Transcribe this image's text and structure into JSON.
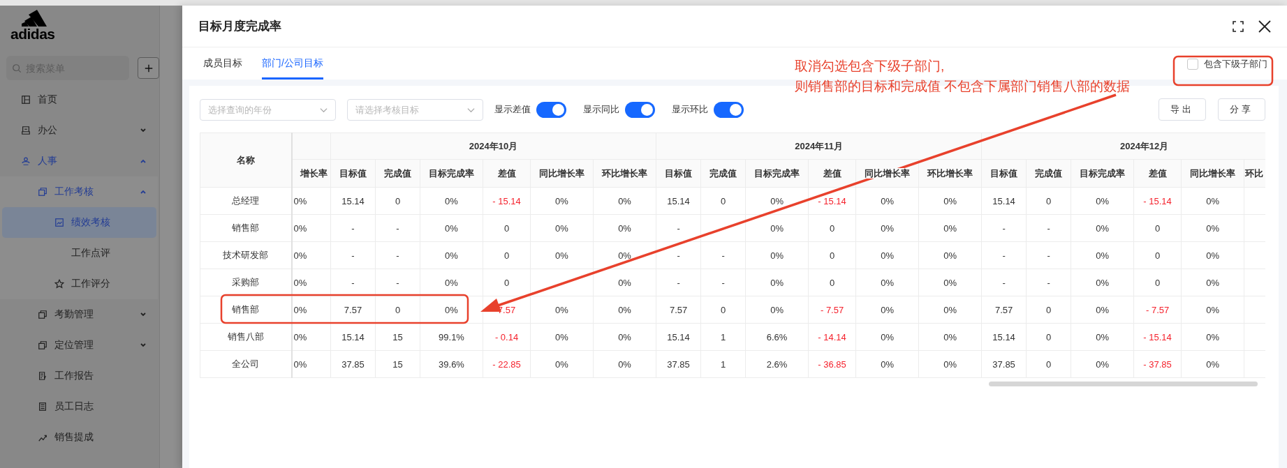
{
  "app": {
    "logo_text": "adidas",
    "search_placeholder": "搜索菜单",
    "menu": [
      {
        "label": "首页",
        "selected": false
      },
      {
        "label": "办公",
        "expanded": false,
        "selected": false
      },
      {
        "label": "人事",
        "expanded": true,
        "selected": false,
        "children": [
          {
            "label": "工作考核",
            "expanded": true,
            "selected": false,
            "children": [
              {
                "label": "绩效考核",
                "selected": true
              },
              {
                "label": "工作点评",
                "selected": false
              },
              {
                "label": "工作评分",
                "selected": false
              }
            ]
          },
          {
            "label": "考勤管理",
            "expanded": false,
            "selected": false
          },
          {
            "label": "定位管理",
            "expanded": false,
            "selected": false
          },
          {
            "label": "工作报告",
            "selected": false
          },
          {
            "label": "员工日志",
            "selected": false
          },
          {
            "label": "销售提成",
            "selected": false
          }
        ]
      }
    ]
  },
  "drawer": {
    "title": "目标月度完成率",
    "tabs": [
      {
        "label": "成员目标",
        "selected": false
      },
      {
        "label": "部门/公司目标",
        "selected": true
      }
    ],
    "include_sub": {
      "label": "包含下级子部门",
      "checked": false
    },
    "filters": [
      {
        "placeholder": "选择查询的年份"
      },
      {
        "placeholder": "请选择考核目标"
      }
    ],
    "toggles": [
      {
        "label": "显示差值",
        "on": true
      },
      {
        "label": "显示同比",
        "on": true
      },
      {
        "label": "显示环比",
        "on": true
      }
    ],
    "buttons": [
      "导出",
      "分享"
    ],
    "table": {
      "name_header": "名称",
      "lead_header": "增长率",
      "months": [
        {
          "label": "2024年10月",
          "columns": [
            "目标值",
            "完成值",
            "目标完成率",
            "差值",
            "同比增长率",
            "环比增长率"
          ]
        },
        {
          "label": "2024年11月",
          "columns": [
            "目标值",
            "完成值",
            "目标完成率",
            "差值",
            "同比增长率",
            "环比增长率"
          ]
        },
        {
          "label": "2024年12月",
          "columns": [
            "目标值",
            "完成值",
            "目标完成率",
            "差值",
            "同比增长率",
            "环比"
          ]
        }
      ],
      "rows": [
        {
          "name": "总经理",
          "lead": "0%",
          "months": [
            {
              "target": "15.14",
              "done": "0",
              "rate": "0%",
              "diff": "- 15.14",
              "negative": true,
              "yoy": "0%",
              "mom": "0%"
            },
            {
              "target": "15.14",
              "done": "0",
              "rate": "0%",
              "diff": "- 15.14",
              "negative": true,
              "yoy": "0%",
              "mom": "0%"
            },
            {
              "target": "15.14",
              "done": "0",
              "rate": "0%",
              "diff": "- 15.14",
              "negative": true,
              "yoy": "0%"
            }
          ]
        },
        {
          "name": "销售部",
          "lead": "0%",
          "months": [
            {
              "target": "-",
              "done": "-",
              "rate": "0%",
              "diff": "0",
              "negative": false,
              "yoy": "0%",
              "mom": "0%"
            },
            {
              "target": "-",
              "rate": "0%",
              "diff": "0",
              "negative": false,
              "yoy": "0%",
              "mom": "0%"
            },
            {
              "target": "-",
              "done": "-",
              "rate": "0%",
              "diff": "0",
              "negative": false,
              "yoy": "0%"
            }
          ]
        },
        {
          "name": "技术研发部",
          "lead": "0%",
          "months": [
            {
              "target": "-",
              "done": "-",
              "rate": "0%",
              "diff": "0",
              "negative": false,
              "yoy": "0%",
              "mom": "0%"
            },
            {
              "target": "-",
              "done": "-",
              "rate": "0%",
              "diff": "0",
              "negative": false,
              "yoy": "0%",
              "mom": "0%"
            },
            {
              "target": "-",
              "done": "-",
              "rate": "0%",
              "diff": "0",
              "negative": false,
              "yoy": "0%"
            }
          ]
        },
        {
          "name": "采购部",
          "lead": "0%",
          "months": [
            {
              "target": "-",
              "done": "-",
              "rate": "0%",
              "diff": "0",
              "negative": false,
              "mom": "0%"
            },
            {
              "target": "-",
              "done": "-",
              "rate": "0%",
              "diff": "0",
              "negative": false,
              "yoy": "0%",
              "mom": "0%"
            },
            {
              "target": "-",
              "done": "-",
              "rate": "0%",
              "diff": "0",
              "negative": false,
              "yoy": "0%"
            }
          ]
        },
        {
          "name": "销售部",
          "lead": "0%",
          "months": [
            {
              "target": "7.57",
              "done": "0",
              "rate": "0%",
              "diff": "7.57",
              "negative": true,
              "yoy": "0%",
              "mom": "0%"
            },
            {
              "target": "7.57",
              "done": "0",
              "rate": "0%",
              "diff": "- 7.57",
              "negative": true,
              "yoy": "0%",
              "mom": "0%"
            },
            {
              "target": "7.57",
              "done": "0",
              "rate": "0%",
              "diff": "- 7.57",
              "negative": true,
              "yoy": "0%"
            }
          ]
        },
        {
          "name": "销售八部",
          "lead": "0%",
          "months": [
            {
              "target": "15.14",
              "done": "15",
              "rate": "99.1%",
              "diff": "- 0.14",
              "negative": true,
              "yoy": "0%",
              "mom": "0%"
            },
            {
              "target": "15.14",
              "done": "1",
              "rate": "6.6%",
              "diff": "- 14.14",
              "negative": true,
              "yoy": "0%",
              "mom": "0%"
            },
            {
              "target": "15.14",
              "done": "0",
              "rate": "0%",
              "diff": "- 15.14",
              "negative": true,
              "yoy": "0%"
            }
          ]
        },
        {
          "name": "全公司",
          "lead": "0%",
          "months": [
            {
              "target": "37.85",
              "done": "15",
              "rate": "39.6%",
              "diff": "- 22.85",
              "negative": true,
              "yoy": "0%",
              "mom": "0%"
            },
            {
              "target": "37.85",
              "done": "1",
              "rate": "2.6%",
              "diff": "- 36.85",
              "negative": true,
              "yoy": "0%",
              "mom": "0%"
            },
            {
              "target": "37.85",
              "done": "0",
              "rate": "0%",
              "diff": "- 37.85",
              "negative": true,
              "yoy": "0%"
            }
          ]
        }
      ]
    }
  },
  "annotation": {
    "lines": [
      "取消勾选包含下级子部门,",
      "则销售部的目标和完成值 不包含下属部门销售八部的数据"
    ]
  }
}
